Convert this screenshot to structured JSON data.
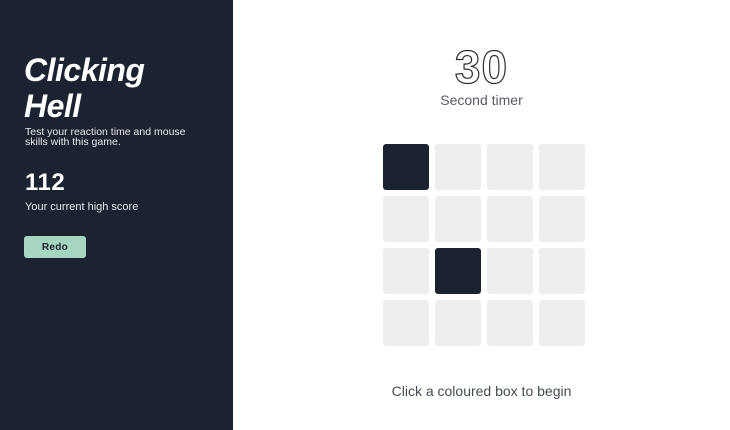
{
  "sidebar": {
    "title": "Clicking Hell",
    "subtitle": "Test your reaction time and mouse skills with this game.",
    "high_score": "112",
    "high_score_label": "Your current high score",
    "redo_label": "Redo"
  },
  "timer": {
    "value": "30",
    "label": "Second timer"
  },
  "grid": {
    "rows": 4,
    "cols": 4,
    "active_cells": [
      0,
      9
    ],
    "colors": {
      "active": "#1c2330",
      "inactive": "#ededed"
    }
  },
  "instruction": "Click a coloured box to begin",
  "colors": {
    "sidebar_bg": "#1c2330",
    "accent": "#a4d6c0"
  }
}
